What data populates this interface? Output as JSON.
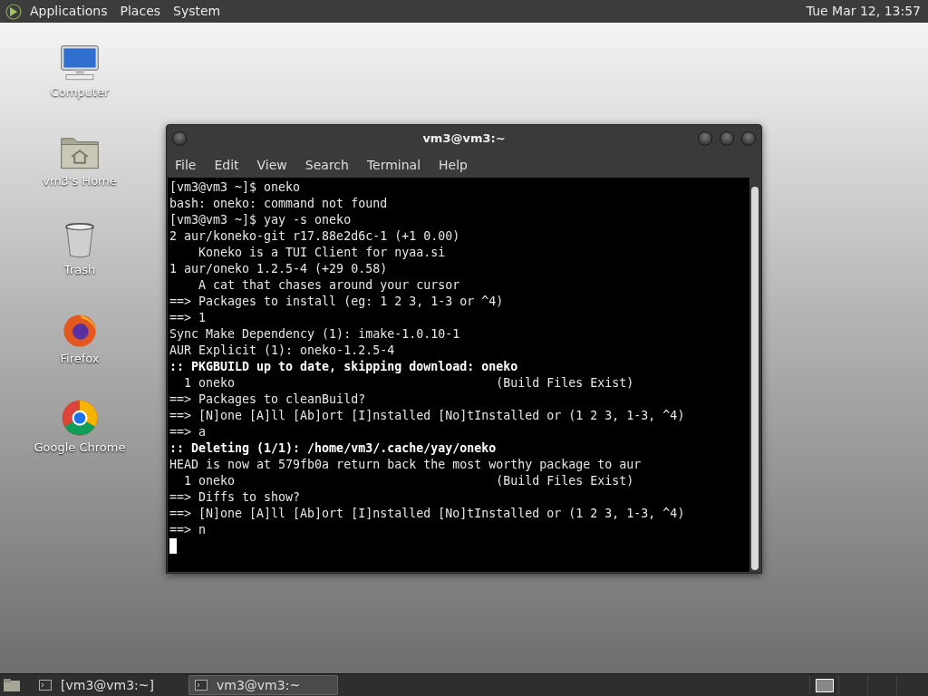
{
  "top_panel": {
    "menus": [
      "Applications",
      "Places",
      "System"
    ],
    "clock": "Tue Mar 12, 13:57"
  },
  "desktop_icons": [
    {
      "kind": "computer",
      "label": "Computer"
    },
    {
      "kind": "home",
      "label": "vm3's Home"
    },
    {
      "kind": "trash",
      "label": "Trash"
    },
    {
      "kind": "firefox",
      "label": "Firefox"
    },
    {
      "kind": "chrome",
      "label": "Google Chrome"
    }
  ],
  "terminal": {
    "title": "vm3@vm3:~",
    "menu": [
      "File",
      "Edit",
      "View",
      "Search",
      "Terminal",
      "Help"
    ],
    "lines": [
      {
        "text": "[vm3@vm3 ~]$ oneko",
        "bold": false
      },
      {
        "text": "bash: oneko: command not found",
        "bold": false
      },
      {
        "text": "[vm3@vm3 ~]$ yay -s oneko",
        "bold": false
      },
      {
        "text": "2 aur/koneko-git r17.88e2d6c-1 (+1 0.00)",
        "bold": false
      },
      {
        "text": "    Koneko is a TUI Client for nyaa.si",
        "bold": false
      },
      {
        "text": "1 aur/oneko 1.2.5-4 (+29 0.58)",
        "bold": false
      },
      {
        "text": "    A cat that chases around your cursor",
        "bold": false
      },
      {
        "text": "==> Packages to install (eg: 1 2 3, 1-3 or ^4)",
        "bold": false
      },
      {
        "text": "==> 1",
        "bold": false
      },
      {
        "text": "Sync Make Dependency (1): imake-1.0.10-1",
        "bold": false
      },
      {
        "text": "AUR Explicit (1): oneko-1.2.5-4",
        "bold": false
      },
      {
        "text": ":: PKGBUILD up to date, skipping download: oneko",
        "bold": true
      },
      {
        "text": "  1 oneko                                    (Build Files Exist)",
        "bold": false
      },
      {
        "text": "==> Packages to cleanBuild?",
        "bold": false
      },
      {
        "text": "==> [N]one [A]ll [Ab]ort [I]nstalled [No]tInstalled or (1 2 3, 1-3, ^4)",
        "bold": false
      },
      {
        "text": "==> a",
        "bold": false
      },
      {
        "text": ":: Deleting (1/1): /home/vm3/.cache/yay/oneko",
        "bold": true
      },
      {
        "text": "HEAD is now at 579fb0a return back the most worthy package to aur",
        "bold": false
      },
      {
        "text": "  1 oneko                                    (Build Files Exist)",
        "bold": false
      },
      {
        "text": "==> Diffs to show?",
        "bold": false
      },
      {
        "text": "==> [N]one [A]ll [Ab]ort [I]nstalled [No]tInstalled or (1 2 3, 1-3, ^4)",
        "bold": false
      },
      {
        "text": "==> n",
        "bold": false
      }
    ]
  },
  "taskbar": {
    "items": [
      {
        "label": "[vm3@vm3:~]",
        "selected": false
      },
      {
        "label": "vm3@vm3:~",
        "selected": true
      }
    ],
    "workspaces": [
      {
        "selected": true
      },
      {
        "selected": false
      },
      {
        "selected": false
      },
      {
        "selected": false
      }
    ]
  }
}
